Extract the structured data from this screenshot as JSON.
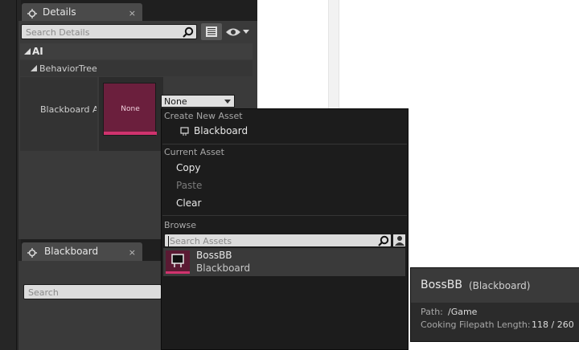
{
  "details": {
    "tab_title": "Details",
    "close_glyph": "×",
    "search_placeholder": "Search Details",
    "category_ai": "AI",
    "subcategory": "BehaviorTree",
    "property_label": "Blackboard As",
    "thumb_label": "None",
    "combo_value": "None"
  },
  "blackboard": {
    "tab_title": "Blackboard",
    "close_glyph": "×",
    "search_placeholder": "Search"
  },
  "menu": {
    "create_label": "Create New Asset",
    "create_item": "Blackboard",
    "current_label": "Current Asset",
    "copy": "Copy",
    "paste": "Paste",
    "clear": "Clear",
    "browse_label": "Browse",
    "search_placeholder": "Search Assets",
    "asset": {
      "name": "BossBB",
      "type": "Blackboard"
    }
  },
  "tooltip": {
    "name": "BossBB",
    "type": "(Blackboard)",
    "path_label": "Path:",
    "path_value": "/Game",
    "cooking_label": "Cooking Filepath Length:",
    "cooking_value": "118 / 260"
  },
  "colors": {
    "panel_bg": "#3a3a3a",
    "menu_bg": "#1c1c1c",
    "asset_thumb": "#6b1f3d",
    "asset_thumb_bar": "#d0336e",
    "canvas": "#ffffff"
  },
  "icons": [
    "details-tab-icon",
    "search-icon",
    "list-view-icon",
    "eye-icon",
    "chevron-down-icon",
    "expand-arrow-icon",
    "blackboard-icon",
    "user-icon"
  ]
}
